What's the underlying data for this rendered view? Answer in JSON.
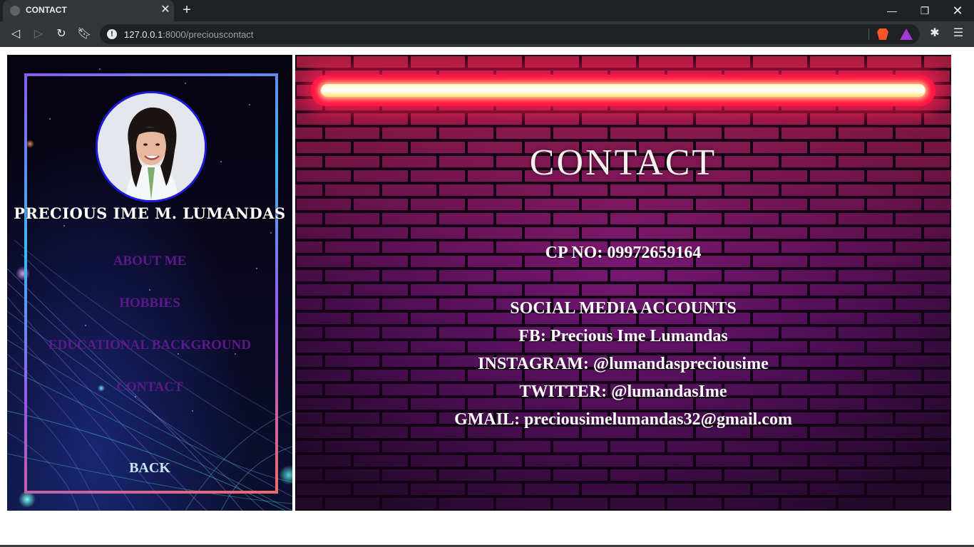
{
  "browser": {
    "tab_title": "CONTACT",
    "url_host": "127.0.0.1",
    "url_path": ":8000/preciouscontact",
    "icons": {
      "favicon": "globe-icon",
      "close_tab": "close-icon",
      "new_tab": "plus-icon",
      "back": "arrow-left-icon",
      "forward": "arrow-right-icon",
      "reload": "reload-icon",
      "bookmark": "bookmark-icon",
      "site_info": "info-icon",
      "brave": "brave-shields-icon",
      "rewards": "brave-rewards-icon",
      "extensions": "puzzle-icon",
      "menu": "menu-icon"
    }
  },
  "sidebar": {
    "name": "PRECIOUS IME M. LUMANDAS",
    "nav": {
      "about": "ABOUT ME",
      "hobbies": "HOBBIES",
      "education": "EDUCATIONAL BACKGROUND",
      "contact": "CONTACT"
    },
    "back": "BACK",
    "colors": {
      "link": "#5b1a8a",
      "back": "#c8e8f4",
      "avatar_border": "#1d1be0"
    }
  },
  "main": {
    "title": "CONTACT",
    "cp": "CP NO: 09972659164",
    "social_heading": "SOCIAL MEDIA ACCOUNTS",
    "fb": "FB: Precious Ime Lumandas",
    "instagram": "INSTAGRAM: @lumandaspreciousime",
    "twitter": "TWITTER: @lumandasIme",
    "gmail": "GMAIL: preciousimelumandas32@gmail.com",
    "colors": {
      "neon": "#ff1744",
      "brick": "#6a1070"
    }
  }
}
